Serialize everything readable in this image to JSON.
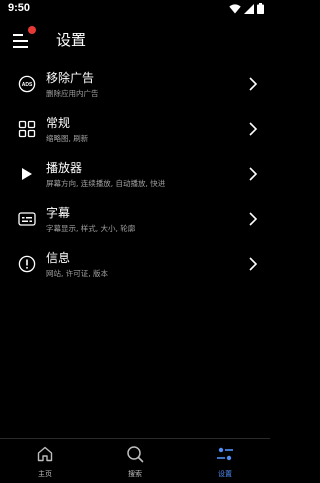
{
  "status_bar": {
    "time": "9:50",
    "icons": [
      "wifi-icon",
      "signal-icon",
      "battery-icon"
    ]
  },
  "header": {
    "title": "设置",
    "menu_icon": "menu-icon",
    "badge_color": "#e53935"
  },
  "settings": [
    {
      "title": "移除广告",
      "subtitle": "删除应用内广告",
      "icon": "ads-icon"
    },
    {
      "title": "常规",
      "subtitle": "缩略图, 刷新",
      "icon": "grid-icon"
    },
    {
      "title": "播放器",
      "subtitle": "屏幕方向, 连续播放, 自动播放, 快进",
      "icon": "play-icon"
    },
    {
      "title": "字幕",
      "subtitle": "字幕显示, 样式, 大小, 轮廓",
      "icon": "subtitles-icon"
    },
    {
      "title": "信息",
      "subtitle": "网站, 许可证, 版本",
      "icon": "info-icon"
    }
  ],
  "bottom_nav": {
    "tabs": [
      {
        "label": "主页",
        "icon": "home-icon",
        "active": false
      },
      {
        "label": "搜索",
        "icon": "search-icon",
        "active": false
      },
      {
        "label": "设置",
        "icon": "settings-sliders-icon",
        "active": true
      }
    ],
    "active_color": "#4f8ff7"
  }
}
